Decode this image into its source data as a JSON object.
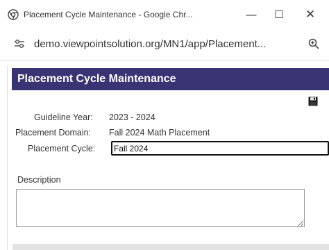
{
  "window": {
    "title": "Placement Cycle Maintenance - Google Chr...",
    "minimize_symbol": "—",
    "maximize_symbol": "☐",
    "close_symbol": "✕",
    "browser_icon": "chrome-icon"
  },
  "address_bar": {
    "url": "demo.viewpointsolution.org/MN1/app/Placement...",
    "site_info_icon": "site-settings-icon",
    "zoom_icon": "zoom-icon"
  },
  "page": {
    "header_title": "Placement Cycle Maintenance",
    "header_color": "#3a3474",
    "save_icon": "floppy-disk-icon",
    "fields": {
      "guideline_year_label": "Guideline Year:",
      "guideline_year_value": "2023 - 2024",
      "placement_domain_label": "Placement Domain:",
      "placement_domain_value": "Fall 2024 Math Placement",
      "placement_cycle_label": "Placement Cycle:",
      "placement_cycle_value": "Fall 2024"
    },
    "description_label": "Description",
    "description_value": ""
  }
}
